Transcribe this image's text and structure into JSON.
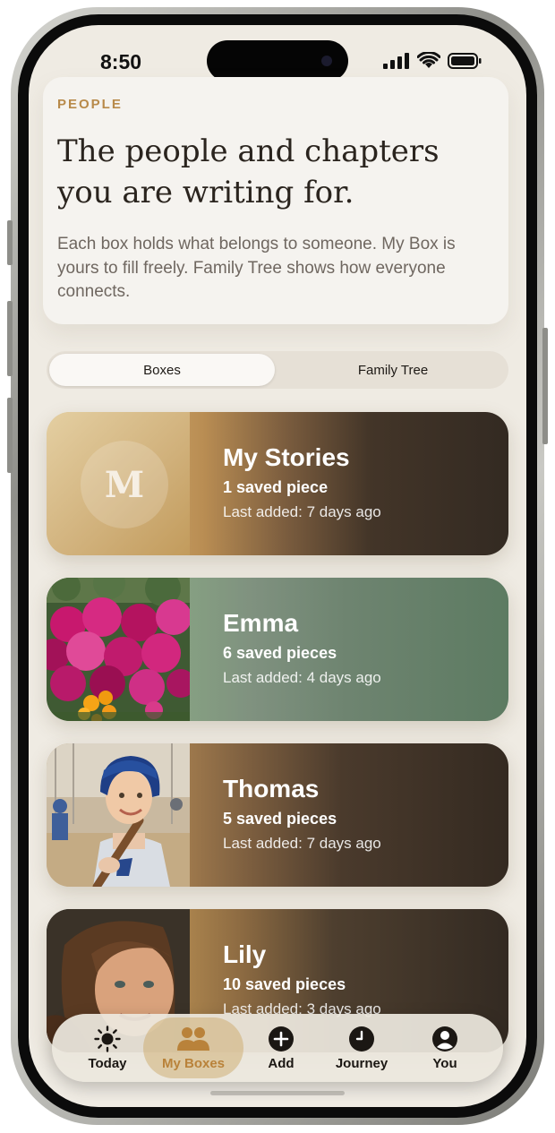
{
  "status_bar": {
    "time": "8:50"
  },
  "header": {
    "eyebrow": "PEOPLE",
    "headline": "The people and chapters you are writing for.",
    "description": "Each box holds what belongs to someone. My Box is yours to fill freely. Family Tree shows how everyone connects."
  },
  "segmented": {
    "boxes_label": "Boxes",
    "tree_label": "Family Tree",
    "selected": "Boxes"
  },
  "boxes": [
    {
      "name": "My Stories",
      "count": "1 saved piece",
      "last_added": "Last added: 7 days ago",
      "monogram": "M",
      "accent": "#c8a163"
    },
    {
      "name": "Emma",
      "count": "6 saved pieces",
      "last_added": "Last added: 4 days ago",
      "accent": "#62806a"
    },
    {
      "name": "Thomas",
      "count": "5 saved pieces",
      "last_added": "Last added: 7 days ago",
      "accent": "#b8905a"
    },
    {
      "name": "Lily",
      "count": "10 saved pieces",
      "last_added": "Last added: 3 days ago",
      "accent": "#b8905a"
    }
  ],
  "tab_bar": {
    "items": [
      {
        "label": "Today",
        "icon": "sun-icon"
      },
      {
        "label": "My Boxes",
        "icon": "people-icon"
      },
      {
        "label": "Add",
        "icon": "plus-circle-icon"
      },
      {
        "label": "Journey",
        "icon": "clock-icon"
      },
      {
        "label": "You",
        "icon": "person-circle-icon"
      }
    ],
    "active": "My Boxes"
  },
  "colors": {
    "background": "#efebe3",
    "accent_gold": "#b88a4a",
    "dark_brown": "#3a2f26",
    "sage_green": "#62806a"
  }
}
